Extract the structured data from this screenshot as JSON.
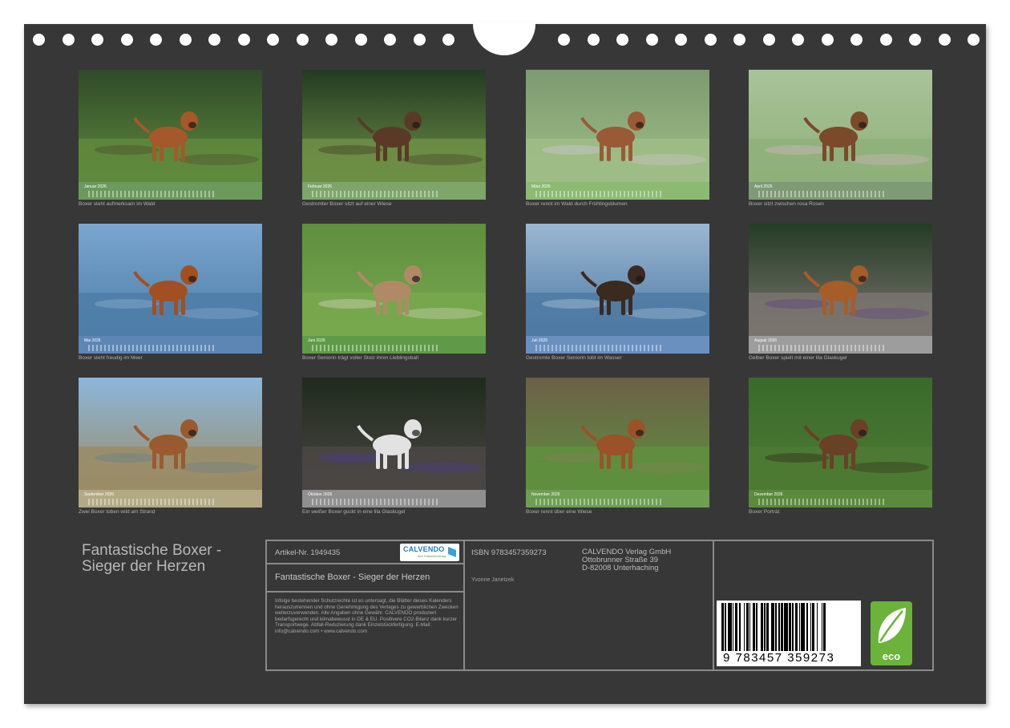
{
  "calendar": {
    "title_line1": "Fantastische Boxer -",
    "title_line2": "Sieger der Herzen",
    "months": [
      {
        "label": "Januar 2026",
        "caption": "Boxer steht aufmerksam im Wald",
        "strip_color": "#6b9a5c",
        "scene": "forest"
      },
      {
        "label": "Februar 2026",
        "caption": "Gestromter Boxer sitzt auf einer Wiese",
        "strip_color": "#7ea56a",
        "scene": "meadow-dark"
      },
      {
        "label": "März 2026",
        "caption": "Boxer rennt im Wald durch Frühlingsblumen",
        "strip_color": "#8cba72",
        "scene": "flowers"
      },
      {
        "label": "April 2026",
        "caption": "Boxer sitzt zwischen rosa Rosen",
        "strip_color": "#7f9a76",
        "scene": "roses"
      },
      {
        "label": "Mai 2026",
        "caption": "Boxer steht freudig im Meer",
        "strip_color": "#5d86b5",
        "scene": "sea"
      },
      {
        "label": "Juni 2026",
        "caption": "Boxer Seniorin trägt voller Stolz ihren Lieblingsball",
        "strip_color": "#5f9a48",
        "scene": "grass"
      },
      {
        "label": "Juli 2026",
        "caption": "Gestromte Boxer Seniorin tobt im Wasser",
        "strip_color": "#6a90c0",
        "scene": "sea2"
      },
      {
        "label": "August 2026",
        "caption": "Gelber Boxer spielt mit einer lila Glaskugel",
        "strip_color": "#9d9d9d",
        "scene": "path"
      },
      {
        "label": "September 2026",
        "caption": "Zwei Boxer toben wild am Strand",
        "strip_color": "#b3aa85",
        "scene": "beach"
      },
      {
        "label": "Oktober 2026",
        "caption": "Ein weißer Boxer guckt in eine lila Glaskugel",
        "strip_color": "#8f8f8f",
        "scene": "dark"
      },
      {
        "label": "November 2026",
        "caption": "Boxer rennt über eine Wiese",
        "strip_color": "#6d9e52",
        "scene": "autumn"
      },
      {
        "label": "Dezember 2026",
        "caption": "Boxer Porträt",
        "strip_color": "#5b8a3c",
        "scene": "portrait"
      }
    ]
  },
  "info": {
    "artikel": "Artikel-Nr. 1949435",
    "product_title": "Fantastische Boxer - Sieger der Herzen",
    "legal": "Infolge bestehender Schutzrechte ist es untersagt, die Blätter dieses Kalenders herauszutrennen und ohne Genehmigung des Verlages zu gewerblichen Zwecken weiterzuverwenden. Alle Angaben ohne Gewähr. CALVENDO produziert bedarfsgerecht und klimabewusst in DE & EU. Positivere CO2-Bilanz dank kurzer Transportwege. Abfall-Reduzierung dank Einzelstückfertigung. E-Mail: info@calvendo.com • www.calvendo.com",
    "isbn": "ISBN 9783457359273",
    "author": "Yvonne Janetzek",
    "publisher_line1": "CALVENDO Verlag GmbH",
    "publisher_line2": "Ottobrunner Straße 39",
    "publisher_line3": "D-82008 Unterhaching",
    "logo_text": "CALVENDO",
    "logo_sub": "Ihre Kalenderverlag",
    "barcode_number": "9 783457 359273",
    "eco_label": "eco"
  }
}
